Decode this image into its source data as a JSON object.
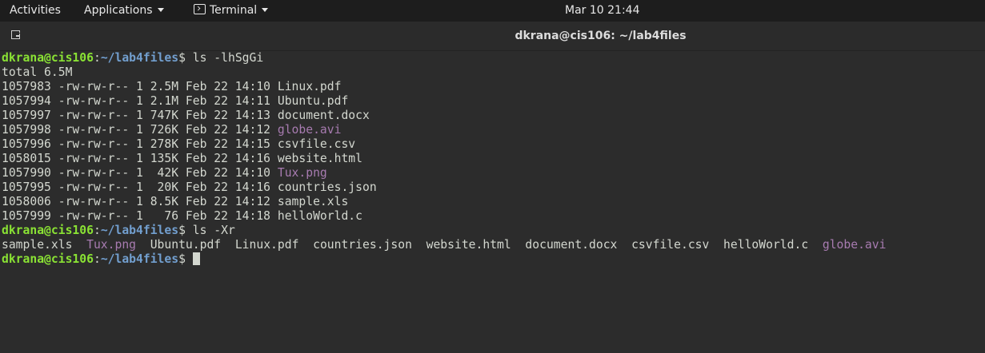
{
  "topbar": {
    "activities": "Activities",
    "applications": "Applications",
    "terminal": "Terminal",
    "datetime": "Mar 10  21:44"
  },
  "window": {
    "title": "dkrana@cis106: ~/lab4files"
  },
  "terminal": {
    "prompt1": {
      "user": "dkrana@cis106",
      "sep": ":",
      "path": "~/lab4files",
      "sym": "$ ",
      "cmd": "ls -lhSgGi"
    },
    "total": "total 6.5M",
    "listing": [
      {
        "meta": "1057983 -rw-rw-r-- 1 2.5M Feb 22 14:10 ",
        "name": "Linux.pdf"
      },
      {
        "meta": "1057994 -rw-rw-r-- 1 2.1M Feb 22 14:11 ",
        "name": "Ubuntu.pdf"
      },
      {
        "meta": "1057997 -rw-rw-r-- 1 747K Feb 22 14:13 ",
        "name": "document.docx"
      },
      {
        "meta": "1057998 -rw-rw-r-- 1 726K Feb 22 14:12 ",
        "name": "globe.avi"
      },
      {
        "meta": "1057996 -rw-rw-r-- 1 278K Feb 22 14:15 ",
        "name": "csvfile.csv"
      },
      {
        "meta": "1058015 -rw-rw-r-- 1 135K Feb 22 14:16 ",
        "name": "website.html"
      },
      {
        "meta": "1057990 -rw-rw-r-- 1  42K Feb 22 14:10 ",
        "name": "Tux.png"
      },
      {
        "meta": "1057995 -rw-rw-r-- 1  20K Feb 22 14:16 ",
        "name": "countries.json"
      },
      {
        "meta": "1058006 -rw-rw-r-- 1 8.5K Feb 22 14:12 ",
        "name": "sample.xls"
      },
      {
        "meta": "1057999 -rw-rw-r-- 1   76 Feb 22 14:18 ",
        "name": "helloWorld.c"
      }
    ],
    "prompt2": {
      "user": "dkrana@cis106",
      "sep": ":",
      "path": "~/lab4files",
      "sym": "$ ",
      "cmd": "ls -Xr"
    },
    "xr": [
      {
        "text": "sample.xls",
        "gap": "  "
      },
      {
        "text": "Tux.png",
        "gap": "  "
      },
      {
        "text": "Ubuntu.pdf",
        "gap": "  "
      },
      {
        "text": "Linux.pdf",
        "gap": "  "
      },
      {
        "text": "countries.json",
        "gap": "  "
      },
      {
        "text": "website.html",
        "gap": "  "
      },
      {
        "text": "document.docx",
        "gap": "  "
      },
      {
        "text": "csvfile.csv",
        "gap": "  "
      },
      {
        "text": "helloWorld.c",
        "gap": "  "
      },
      {
        "text": "globe.avi",
        "gap": ""
      }
    ],
    "prompt3": {
      "user": "dkrana@cis106",
      "sep": ":",
      "path": "~/lab4files",
      "sym": "$ "
    }
  }
}
